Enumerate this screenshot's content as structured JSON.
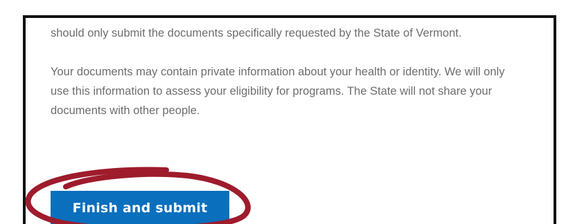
{
  "content": {
    "paragraph_1": "should only submit the documents specifically requested by the State of Vermont.",
    "paragraph_2": "Your documents may contain private information about your health or identity. We will only use this information to assess your eligibility for programs. The State will not share your documents with other people."
  },
  "actions": {
    "submit_label": "Finish and submit"
  },
  "colors": {
    "button": "#0a6fbd",
    "annotation_circle": "#9e1c2c",
    "text": "#6d6d6d",
    "border": "#111111"
  }
}
